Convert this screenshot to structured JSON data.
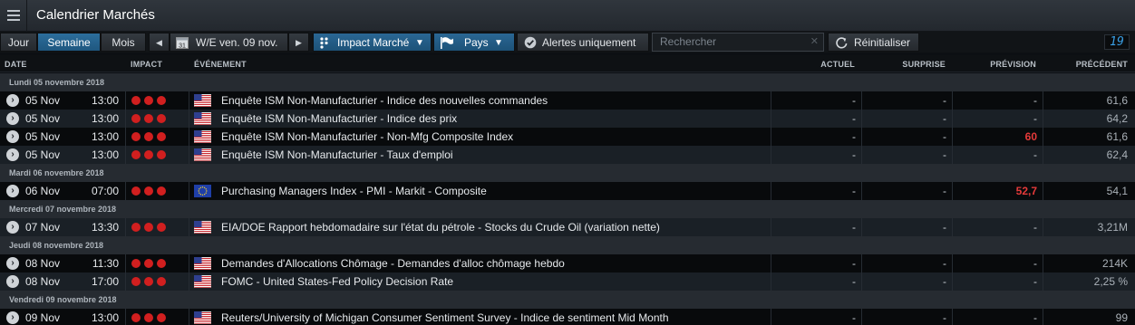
{
  "app": {
    "title": "Calendrier Marchés",
    "counter": "19"
  },
  "toolbar": {
    "tabs": [
      "Jour",
      "Semaine",
      "Mois"
    ],
    "active_tab": "Semaine",
    "period_label": "W/E ven. 09 nov.",
    "calendar_day": "31",
    "impact_label": "Impact Marché",
    "country_label": "Pays",
    "alerts_label": "Alertes uniquement",
    "search_placeholder": "Rechercher",
    "reset_label": "Réinitialiser"
  },
  "columns": {
    "date": "DATE",
    "impact": "IMPACT",
    "event": "ÉVÉNEMENT",
    "actual": "ACTUEL",
    "surprise": "SURPRISE",
    "forecast": "PRÉVISION",
    "previous": "PRÉCÉDENT"
  },
  "colors": {
    "impact_high": "#d11f1f",
    "forecast_highlight": "#e53a3a",
    "accent": "#2a6794"
  },
  "groups": [
    {
      "day": "Lundi 05 novembre 2018",
      "events": [
        {
          "date": "05 Nov",
          "time": "13:00",
          "impact": 3,
          "flag": "us-flag",
          "name": "Enquête ISM Non-Manufacturier - Indice des nouvelles commandes",
          "actual": "-",
          "surprise": "-",
          "forecast": "-",
          "forecast_highlight": false,
          "previous": "61,6"
        },
        {
          "date": "05 Nov",
          "time": "13:00",
          "impact": 3,
          "flag": "us-flag",
          "name": "Enquête ISM Non-Manufacturier - Indice des prix",
          "actual": "-",
          "surprise": "-",
          "forecast": "-",
          "forecast_highlight": false,
          "previous": "64,2"
        },
        {
          "date": "05 Nov",
          "time": "13:00",
          "impact": 3,
          "flag": "us-flag",
          "name": "Enquête ISM Non-Manufacturier - Non-Mfg Composite Index",
          "actual": "-",
          "surprise": "-",
          "forecast": "60",
          "forecast_highlight": true,
          "previous": "61,6"
        },
        {
          "date": "05 Nov",
          "time": "13:00",
          "impact": 3,
          "flag": "us-flag",
          "name": "Enquête ISM Non-Manufacturier - Taux d'emploi",
          "actual": "-",
          "surprise": "-",
          "forecast": "-",
          "forecast_highlight": false,
          "previous": "62,4"
        }
      ]
    },
    {
      "day": "Mardi 06 novembre 2018",
      "events": [
        {
          "date": "06 Nov",
          "time": "07:00",
          "impact": 3,
          "flag": "eu-flag",
          "name": "Purchasing Managers Index - PMI - Markit - Composite",
          "actual": "-",
          "surprise": "-",
          "forecast": "52,7",
          "forecast_highlight": true,
          "previous": "54,1"
        }
      ]
    },
    {
      "day": "Mercredi 07 novembre 2018",
      "events": [
        {
          "date": "07 Nov",
          "time": "13:30",
          "impact": 3,
          "flag": "us-flag",
          "name": "EIA/DOE Rapport hebdomadaire sur l'état du pétrole - Stocks du Crude Oil (variation nette)",
          "actual": "-",
          "surprise": "-",
          "forecast": "-",
          "forecast_highlight": false,
          "previous": "3,21M"
        }
      ]
    },
    {
      "day": "Jeudi 08 novembre 2018",
      "events": [
        {
          "date": "08 Nov",
          "time": "11:30",
          "impact": 3,
          "flag": "us-flag",
          "name": "Demandes d'Allocations Chômage - Demandes d'alloc chômage hebdo",
          "actual": "-",
          "surprise": "-",
          "forecast": "-",
          "forecast_highlight": false,
          "previous": "214K"
        },
        {
          "date": "08 Nov",
          "time": "17:00",
          "impact": 3,
          "flag": "us-flag",
          "name": "FOMC - United States-Fed Policy Decision Rate",
          "actual": "-",
          "surprise": "-",
          "forecast": "-",
          "forecast_highlight": false,
          "previous": "2,25 %"
        }
      ]
    },
    {
      "day": "Vendredi 09 novembre 2018",
      "events": [
        {
          "date": "09 Nov",
          "time": "13:00",
          "impact": 3,
          "flag": "us-flag",
          "name": "Reuters/University of Michigan Consumer Sentiment Survey - Indice de sentiment Mid Month",
          "actual": "-",
          "surprise": "-",
          "forecast": "-",
          "forecast_highlight": false,
          "previous": "99"
        }
      ]
    }
  ]
}
